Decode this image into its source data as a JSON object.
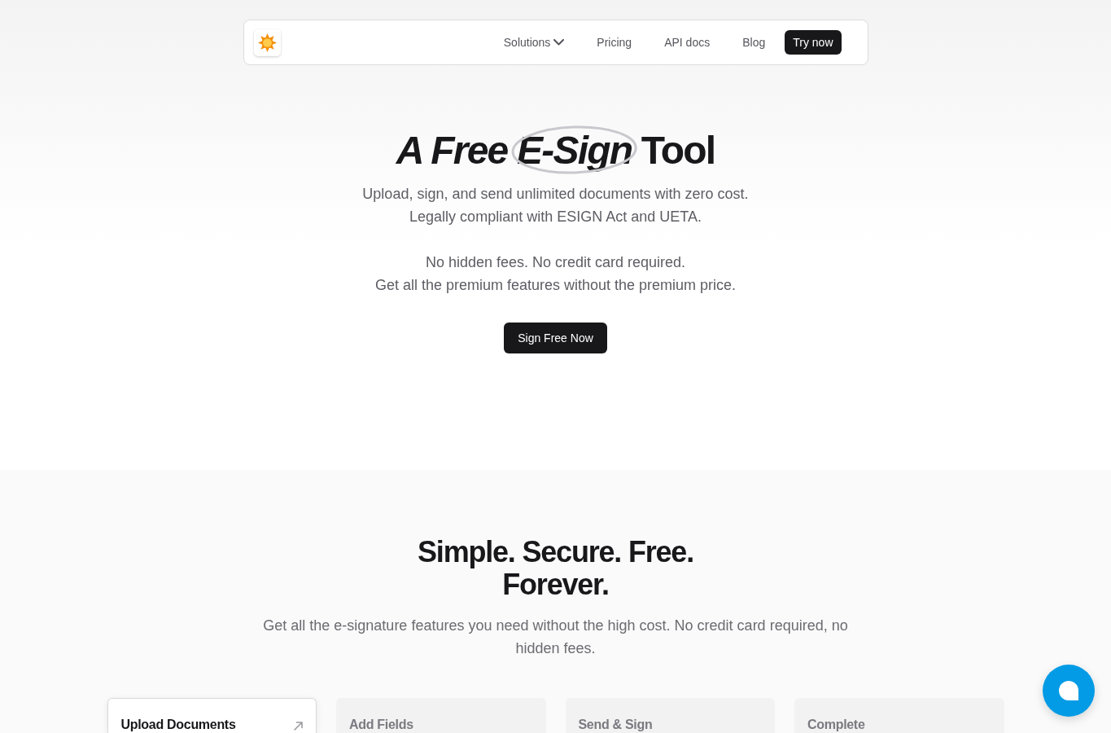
{
  "nav": {
    "links": [
      {
        "label": "Solutions",
        "kind": "dropdown"
      },
      {
        "label": "Pricing",
        "kind": "link"
      },
      {
        "label": "API docs",
        "kind": "link"
      },
      {
        "label": "Blog",
        "kind": "link"
      }
    ],
    "cta": "Try now"
  },
  "hero": {
    "title_parts": [
      {
        "text": "*A Free*",
        "circled": false
      },
      {
        "text": "*E-Sign*",
        "circled": true
      },
      {
        "text": "Tool",
        "circled": false
      }
    ],
    "paragraphs": [
      {
        "lines": [
          "Upload, sign, and send unlimited documents with zero cost.",
          "Legally compliant with ESIGN Act and UETA."
        ]
      },
      {
        "lines": [
          "No hidden fees. No credit card required.",
          "Get all the premium features without the premium price."
        ]
      }
    ],
    "cta": "Sign Free Now"
  },
  "features": {
    "heading": "Simple. Secure. Free. Forever.",
    "description": "Get all the e-signature features you need without the high cost. No credit card required, no hidden fees.",
    "steps": [
      {
        "title": "Upload Documents",
        "selected": true
      },
      {
        "title": "Add Fields",
        "selected": false
      },
      {
        "title": "Send & Sign",
        "selected": false
      },
      {
        "title": "Complete",
        "selected": false
      }
    ]
  }
}
